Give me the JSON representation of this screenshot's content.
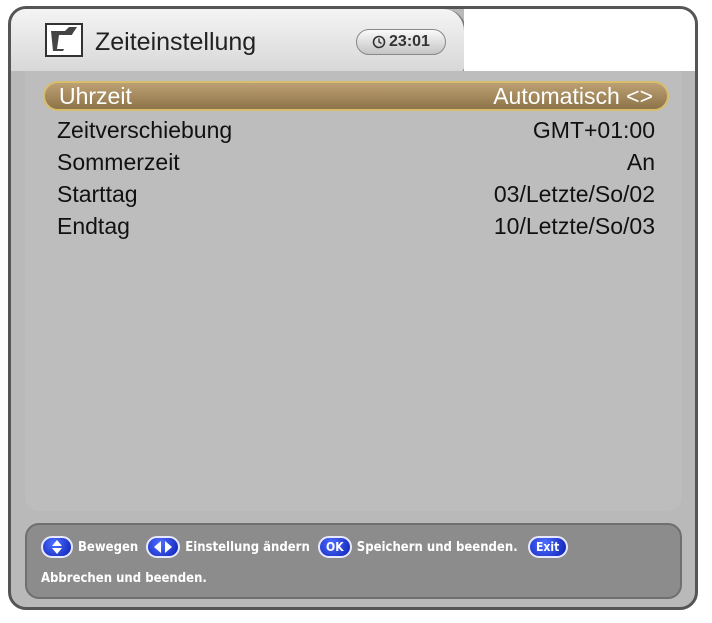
{
  "header": {
    "title": "Zeiteinstellung",
    "clock_time": "23:01",
    "logo_icon": "tv-logo-icon",
    "clock_icon": "clock-icon"
  },
  "settings": [
    {
      "label": "Uhrzeit",
      "value": "Automatisch <>",
      "selected": true
    },
    {
      "label": "Zeitverschiebung",
      "value": "GMT+01:00",
      "selected": false
    },
    {
      "label": "Sommerzeit",
      "value": "An",
      "selected": false
    },
    {
      "label": "Starttag",
      "value": "03/Letzte/So/02",
      "selected": false
    },
    {
      "label": "Endtag",
      "value": "10/Letzte/So/03",
      "selected": false
    }
  ],
  "footer": {
    "updown_text": "Bewegen",
    "leftright_text": "Einstellung ändern",
    "ok_label": "OK",
    "ok_text": "Speichern und beenden.",
    "exit_label": "Exit",
    "exit_text": "Abbrechen und beenden."
  },
  "colors": {
    "selection": "#a88e5e",
    "button_blue": "#1a2fd0",
    "panel": "#bdbdbd",
    "footer": "#8c8c8c"
  }
}
